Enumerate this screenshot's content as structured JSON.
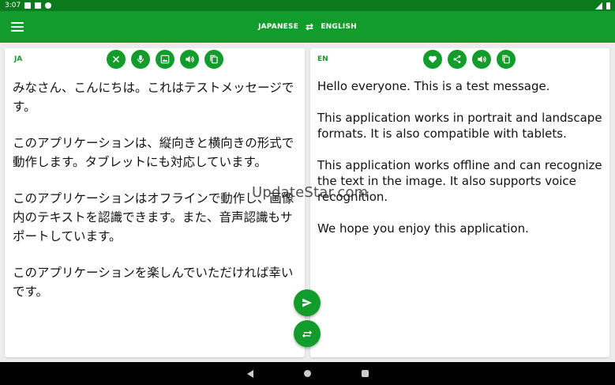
{
  "status": {
    "time": "3:07"
  },
  "appbar": {
    "source_lang": "JAPANESE",
    "target_lang": "ENGLISH",
    "swap_glyph": "⇄"
  },
  "left_panel": {
    "code": "JA",
    "paragraphs": [
      "みなさん、こんにちは。これはテストメッセージです。",
      "このアプリケーションは、縦向きと横向きの形式で動作します。タブレットにも対応しています。",
      "このアプリケーションはオフラインで動作し、画像内のテキストを認識できます。また、音声認識もサポートしています。",
      "このアプリケーションを楽しんでいただければ幸いです。"
    ],
    "actions": [
      "clear-icon",
      "microphone-icon",
      "image-icon",
      "speaker-icon",
      "copy-icon"
    ]
  },
  "right_panel": {
    "code": "EN",
    "paragraphs": [
      "Hello everyone. This is a test message.",
      "This application works in portrait and landscape formats. It is also compatible with tablets.",
      "This application works offline and can recognize the text in the image. It also supports voice recognition.",
      "We hope you enjoy this application."
    ],
    "actions": [
      "heart-icon",
      "share-icon",
      "speaker-icon",
      "copy-icon"
    ]
  },
  "watermark": "UpdateStar.com",
  "colors": {
    "primary": "#119c2b",
    "status_bar": "#0a7a1c",
    "background": "#ececec"
  }
}
